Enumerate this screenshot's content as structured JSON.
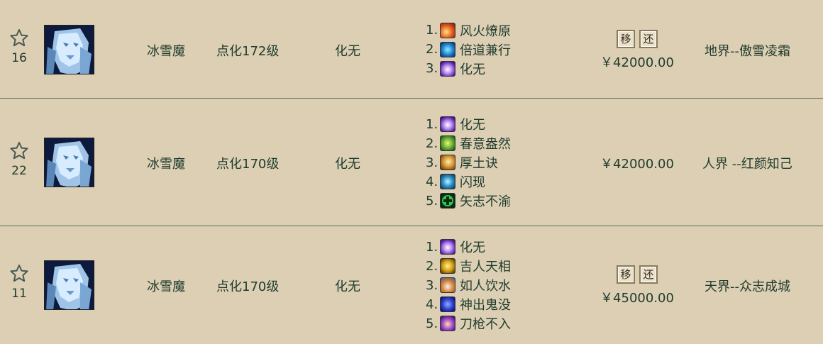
{
  "rows": [
    {
      "fav_count": "16",
      "name": "冰雪魔",
      "level": "点化172级",
      "main_skill": "化无",
      "skills": [
        {
          "num": "1.",
          "label": "风火燎原",
          "icon": "fire-skill-icon"
        },
        {
          "num": "2.",
          "label": "倍道兼行",
          "icon": "wind-skill-icon"
        },
        {
          "num": "3.",
          "label": "化无",
          "icon": "void-skill-icon"
        }
      ],
      "buttons": [
        "移",
        "还"
      ],
      "price": "￥42000.00",
      "server": "地界--傲雪凌霜"
    },
    {
      "fav_count": "22",
      "name": "冰雪魔",
      "level": "点化170级",
      "main_skill": "化无",
      "skills": [
        {
          "num": "1.",
          "label": "化无",
          "icon": "void-skill-icon"
        },
        {
          "num": "2.",
          "label": "春意盎然",
          "icon": "spring-skill-icon"
        },
        {
          "num": "3.",
          "label": "厚土诀",
          "icon": "earth-skill-icon"
        },
        {
          "num": "4.",
          "label": "闪现",
          "icon": "flash-skill-icon"
        },
        {
          "num": "5.",
          "label": "矢志不渝",
          "icon": "cross-skill-icon"
        }
      ],
      "buttons": [],
      "price": "￥42000.00",
      "server": "人界 --红颜知己"
    },
    {
      "fav_count": "11",
      "name": "冰雪魔",
      "level": "点化170级",
      "main_skill": "化无",
      "skills": [
        {
          "num": "1.",
          "label": "化无",
          "icon": "void-skill-icon"
        },
        {
          "num": "2.",
          "label": "吉人天相",
          "icon": "luck-skill-icon"
        },
        {
          "num": "3.",
          "label": "如人饮水",
          "icon": "water-skill-icon"
        },
        {
          "num": "4.",
          "label": "神出鬼没",
          "icon": "hide-skill-icon"
        },
        {
          "num": "5.",
          "label": "刀枪不入",
          "icon": "shield-skill-icon"
        }
      ],
      "buttons": [
        "移",
        "还"
      ],
      "price": "￥45000.00",
      "server": "天界--众志成城"
    }
  ],
  "colors": {
    "background": "#dccfb3",
    "text": "#1f3b2d",
    "divider": "#54705f"
  }
}
